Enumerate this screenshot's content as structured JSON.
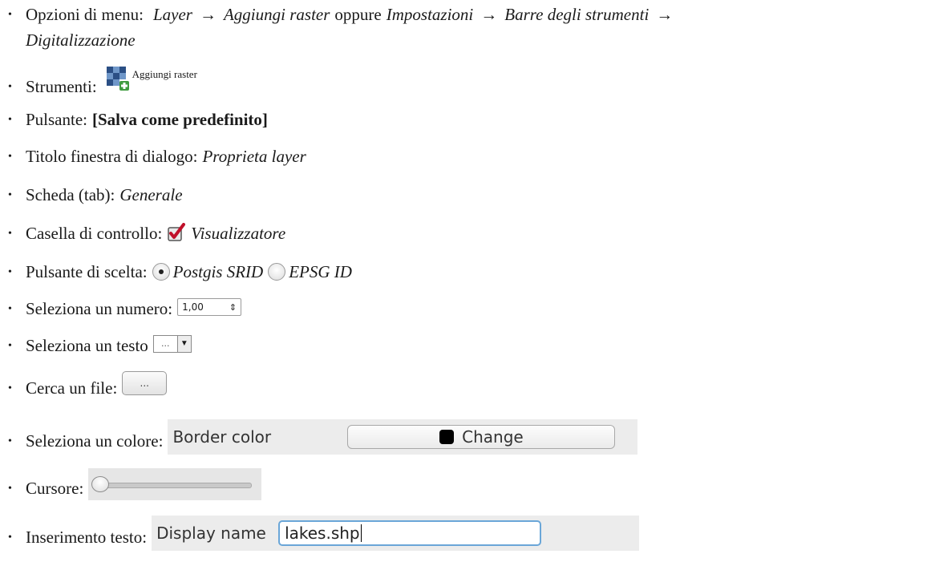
{
  "items": {
    "menu": {
      "label": "Opzioni di menu:",
      "path1_a": "Layer",
      "path1_b": "Aggiungi raster",
      "or": "oppure",
      "path2_a": "Impostazioni",
      "path2_b": "Barre degli strumenti",
      "path2_c": "Digitalizzazione",
      "arrow": "→"
    },
    "tools": {
      "label": "Strumenti:",
      "tool_name": "Aggiungi raster",
      "icon": "add-raster-icon"
    },
    "button": {
      "label": "Pulsante:",
      "value": "[Salva come predefinito]"
    },
    "dialog": {
      "label": "Titolo finestra di dialogo:",
      "value": "Proprieta layer"
    },
    "tab": {
      "label": "Scheda (tab):",
      "value": "Generale"
    },
    "checkbox": {
      "label": "Casella di controllo:",
      "value": "Visualizzatore",
      "checked": true
    },
    "radio": {
      "label": "Pulsante di scelta:",
      "option1": "Postgis SRID",
      "option2": "EPSG ID",
      "selected": "Postgis SRID"
    },
    "number": {
      "label": "Seleziona un numero:",
      "value": "1,00",
      "spin_glyph": "⇕"
    },
    "text_select": {
      "label": "Seleziona un testo",
      "value": "...",
      "dropdown_glyph": "▼"
    },
    "file": {
      "label": "Cerca un file:",
      "button_text": "..."
    },
    "color": {
      "label": "Seleziona un colore:",
      "field_label": "Border color",
      "button_text": "Change",
      "swatch_color": "#000000"
    },
    "slider": {
      "label": "Cursore:",
      "value_fraction": 0.0
    },
    "text_input": {
      "label": "Inserimento testo:",
      "field_label": "Display name",
      "value": "lakes.shp",
      "focus_color": "#6aa6d8"
    }
  },
  "bullet": "•"
}
